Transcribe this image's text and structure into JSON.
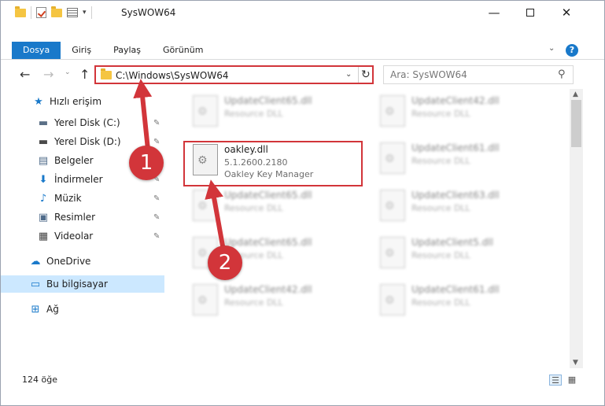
{
  "window": {
    "title": "SysWOW64",
    "minimize_glyph": "—",
    "close_glyph": "✕"
  },
  "ribbon": {
    "tabs": [
      {
        "label": "Dosya"
      },
      {
        "label": "Giriş"
      },
      {
        "label": "Paylaş"
      },
      {
        "label": "Görünüm"
      }
    ],
    "help_glyph": "?",
    "expand_glyph": "⌄"
  },
  "navbar": {
    "back_glyph": "←",
    "forward_glyph": "→",
    "recent_glyph": "⌄",
    "up_glyph": "↑",
    "address_path": "C:\\Windows\\SysWOW64",
    "address_dropdown_glyph": "⌄",
    "refresh_glyph": "↻",
    "search_placeholder": "Ara: SysWOW64",
    "search_glyph": "⚲"
  },
  "sidebar": {
    "items": [
      {
        "label": "Hızlı erişim",
        "icon": "star-icon",
        "glyph": "★",
        "color": "#1979ca",
        "pinned": false
      },
      {
        "label": "Yerel Disk (C:)",
        "icon": "drive-icon",
        "glyph": "▬",
        "color": "#5a6f86",
        "pinned": true
      },
      {
        "label": "Yerel Disk (D:)",
        "icon": "drive-icon",
        "glyph": "▬",
        "color": "#4a4a4a",
        "pinned": true
      },
      {
        "label": "Belgeler",
        "icon": "documents-icon",
        "glyph": "▤",
        "color": "#4f6b8a",
        "pinned": true
      },
      {
        "label": "İndirmeler",
        "icon": "download-icon",
        "glyph": "⬇",
        "color": "#1979ca",
        "pinned": true
      },
      {
        "label": "Müzik",
        "icon": "music-icon",
        "glyph": "♪",
        "color": "#1979ca",
        "pinned": true
      },
      {
        "label": "Resimler",
        "icon": "pictures-icon",
        "glyph": "▣",
        "color": "#4f6b8a",
        "pinned": true
      },
      {
        "label": "Videolar",
        "icon": "video-icon",
        "glyph": "▦",
        "color": "#444444",
        "pinned": true
      },
      {
        "label": "OneDrive",
        "icon": "cloud-icon",
        "glyph": "☁",
        "color": "#1979ca",
        "pinned": false
      },
      {
        "label": "Bu bilgisayar",
        "icon": "computer-icon",
        "glyph": "▭",
        "color": "#1979ca",
        "pinned": false,
        "selected": true
      },
      {
        "label": "Ağ",
        "icon": "network-icon",
        "glyph": "⊞",
        "color": "#1979ca",
        "pinned": false
      }
    ],
    "pin_glyph": "✎"
  },
  "files": {
    "highlighted": {
      "name": "oakley.dll",
      "version": "5.1.2600.2180",
      "description": "Oakley Key Manager"
    },
    "blurred": [
      {
        "name": "UpdateClient65.dll",
        "description": "Resource DLL"
      },
      {
        "name": "UpdateClient42.dll",
        "description": "Resource DLL"
      },
      {
        "name": "UpdateClient61.dll",
        "description": "Resource DLL"
      },
      {
        "name": "UpdateClient65.dll",
        "description": "Resource DLL"
      },
      {
        "name": "UpdateClient63.dll",
        "description": "Resource DLL"
      },
      {
        "name": "UpdateClient65.dll",
        "description": "Resource DLL"
      },
      {
        "name": "UpdateClient5.dll",
        "description": "Resource DLL"
      },
      {
        "name": "UpdateClient42.dll",
        "description": "Resource DLL"
      },
      {
        "name": "UpdateClient61.dll",
        "description": "Resource DLL"
      }
    ]
  },
  "scrollbar": {
    "up_glyph": "▲",
    "down_glyph": "▼"
  },
  "statusbar": {
    "item_count": "124 öğe",
    "details_view_glyph": "☰",
    "tiles_view_glyph": "▦"
  },
  "annotations": {
    "step1": "1",
    "step2": "2",
    "accent_color": "#d2353a"
  }
}
